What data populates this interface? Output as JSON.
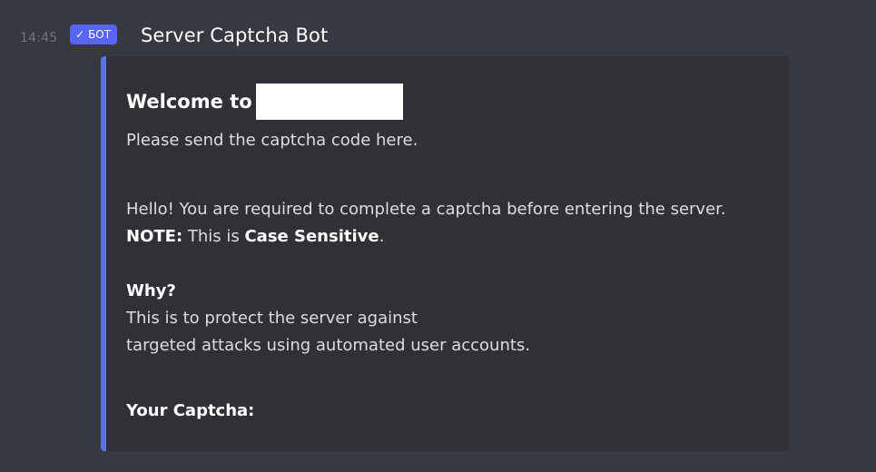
{
  "message": {
    "timestamp": "14:45",
    "bot_tag": {
      "check_icon": "✓",
      "label": "БОТ"
    },
    "username": "Server Captcha Bot"
  },
  "embed": {
    "accent_color": "#5b73dd",
    "title": "Welcome to",
    "description": "Please send the captcha code here.",
    "intro": "Hello! You are required to complete a captcha before entering the server.",
    "note_label": "NOTE:",
    "note_text_before": " This is ",
    "note_emphasis": "Case Sensitive",
    "note_text_after": ".",
    "why_heading": "Why?",
    "why_line1": "This is to protect the server against",
    "why_line2": "targeted attacks using automated user accounts.",
    "captcha_heading": "Your Captcha:"
  }
}
